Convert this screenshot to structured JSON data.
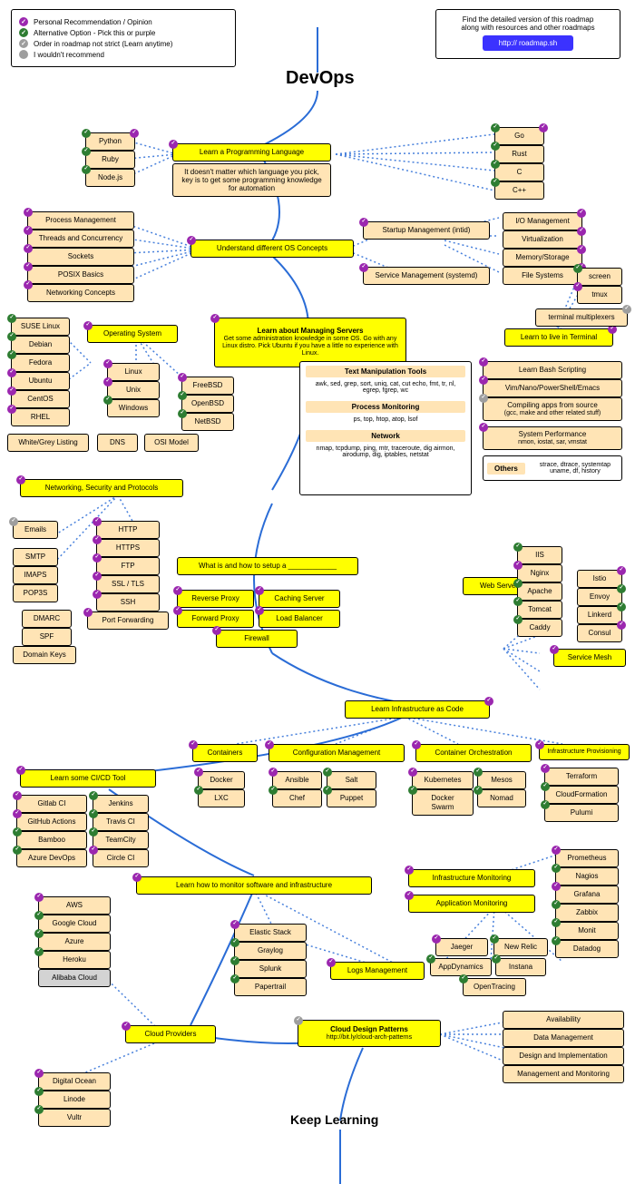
{
  "title": "DevOps",
  "keep_learning": "Keep Learning",
  "legend": {
    "purple": "Personal Recommendation / Opinion",
    "green": "Alternative Option - Pick this or purple",
    "grey_order": "Order in roadmap not strict (Learn anytime)",
    "grey_no": "I wouldn't recommend"
  },
  "promo": {
    "line1": "Find the detailed version of this roadmap",
    "line2": "along with resources and other roadmaps",
    "button": "http:// roadmap.sh"
  },
  "lang": {
    "heading": "Learn a Programming Language",
    "note": "It doesn't matter which language you pick, key is to get some programming knowledge for automation",
    "python": "Python",
    "ruby": "Ruby",
    "node": "Node.js",
    "go": "Go",
    "rust": "Rust",
    "c": "C",
    "cpp": "C++"
  },
  "os": {
    "heading": "Understand different OS Concepts",
    "proc": "Process Management",
    "threads": "Threads and Concurrency",
    "sockets": "Sockets",
    "posix": "POSIX Basics",
    "net": "Networking Concepts",
    "startup": "Startup Management (intid)",
    "service": "Service Management (systemd)",
    "io": "I/O Management",
    "virt": "Virtualization",
    "mem": "Memory/Storage",
    "fs": "File Systems"
  },
  "servers": {
    "heading": "Learn about Managing Servers",
    "note": "Get some administration knowledge in some OS. Go with any Linux distro. Pick Ubuntu if you have a little no experience with Linux.",
    "operating_system": "Operating System",
    "linux": "Linux",
    "unix": "Unix",
    "windows": "Windows",
    "freebsd": "FreeBSD",
    "openbsd": "OpenBSD",
    "netbsd": "NetBSD",
    "suse": "SUSE Linux",
    "debian": "Debian",
    "fedora": "Fedora",
    "ubuntu": "Ubuntu",
    "centos": "CentOS",
    "rhel": "RHEL"
  },
  "terminal": {
    "heading": "Learn to live in Terminal",
    "screen": "screen",
    "tmux": "tmux",
    "mux": "terminal multiplexers",
    "text_hdr": "Text Manipulation Tools",
    "text_list": "awk, sed, grep, sort, uniq, cat, cut echo, fmt, tr, nl, egrep, fgrep, wc",
    "proc_hdr": "Process Monitoring",
    "proc_list": "ps, top, htop, atop, lsof",
    "net_hdr": "Network",
    "net_list": "nmap, tcpdump, ping, mtr, traceroute, dig airmon, airodump, dig, iptables, netstat",
    "bash": "Learn Bash Scripting",
    "editors": "Vim/Nano/PowerShell/Emacs",
    "compile_hdr": "Compiling apps from source",
    "compile_sub": "(gcc, make and other related stuff)",
    "perf_hdr": "System Performance",
    "perf_list": "nmon, iostat, sar, vmstat",
    "others": "Others",
    "others_list": "strace, dtrace, systemtap uname, df, history"
  },
  "network": {
    "heading": "Networking, Security and Protocols",
    "wgl": "White/Grey Listing",
    "dns": "DNS",
    "osi": "OSI Model",
    "emails": "Emails",
    "smtp": "SMTP",
    "imaps": "IMAPS",
    "pop3s": "POP3S",
    "dmarc": "DMARC",
    "spf": "SPF",
    "dkeys": "Domain Keys",
    "http": "HTTP",
    "https": "HTTPS",
    "ftp": "FTP",
    "ssl": "SSL / TLS",
    "ssh": "SSH",
    "portfwd": "Port Forwarding"
  },
  "setup": {
    "heading": "What is and how to setup a ____________",
    "revproxy": "Reverse Proxy",
    "caching": "Caching Server",
    "fwdproxy": "Forward Proxy",
    "lb": "Load Balancer",
    "fw": "Firewall"
  },
  "web": {
    "heading": "Web Server",
    "iis": "IIS",
    "nginx": "Nginx",
    "apache": "Apache",
    "tomcat": "Tomcat",
    "caddy": "Caddy",
    "istio": "Istio",
    "envoy": "Envoy",
    "linkerd": "Linkerd",
    "consul": "Consul",
    "mesh": "Service Mesh"
  },
  "iac": {
    "heading": "Learn Infrastructure as Code",
    "containers": "Containers",
    "docker": "Docker",
    "lxc": "LXC",
    "cm": "Configuration Management",
    "ansible": "Ansible",
    "salt": "Salt",
    "chef": "Chef",
    "puppet": "Puppet",
    "orch": "Container Orchestration",
    "k8s": "Kubernetes",
    "mesos": "Mesos",
    "swarm": "Docker Swarm",
    "nomad": "Nomad",
    "prov": "Infrastructure Provisioning",
    "tf": "Terraform",
    "cf": "CloudFormation",
    "pulumi": "Pulumi"
  },
  "cicd": {
    "heading": "Learn some CI/CD Tool",
    "gitlab": "Gitlab CI",
    "jenkins": "Jenkins",
    "gha": "GitHub Actions",
    "travis": "Travis CI",
    "bamboo": "Bamboo",
    "teamcity": "TeamCity",
    "azdo": "Azure DevOps",
    "circle": "Circle CI"
  },
  "monitor": {
    "heading": "Learn how to monitor software and infrastructure",
    "infra": "Infrastructure Monitoring",
    "app": "Application Monitoring",
    "prometheus": "Prometheus",
    "nagios": "Nagios",
    "grafana": "Grafana",
    "zabbix": "Zabbix",
    "monit": "Monit",
    "datadog": "Datadog",
    "logs": "Logs Management",
    "elastic": "Elastic Stack",
    "graylog": "Graylog",
    "splunk": "Splunk",
    "papertrail": "Papertrail",
    "jaeger": "Jaeger",
    "newrelic": "New Relic",
    "appd": "AppDynamics",
    "instana": "Instana",
    "ot": "OpenTracing"
  },
  "cloud": {
    "heading": "Cloud Providers",
    "aws": "AWS",
    "gcp": "Google Cloud",
    "azure": "Azure",
    "heroku": "Heroku",
    "alibaba": "Alibaba Cloud",
    "do": "Digital Ocean",
    "linode": "Linode",
    "vultr": "Vultr"
  },
  "patterns": {
    "heading": "Cloud Design Patterns",
    "link": "http://bit.ly/cloud-arch-patterns",
    "avail": "Availability",
    "data": "Data Management",
    "design": "Design and Implementation",
    "mgmt": "Management and Monitoring"
  }
}
